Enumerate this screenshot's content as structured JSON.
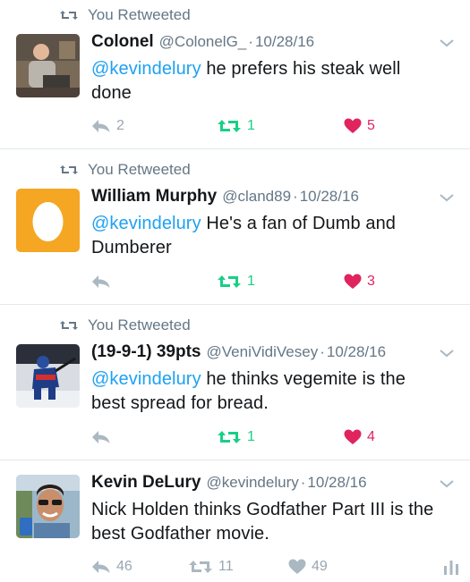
{
  "retweet_label": "You Retweeted",
  "colors": {
    "link": "#1da1f2",
    "retweet_green": "#19cf86",
    "like_red": "#e0245e",
    "muted": "#657786",
    "action_grey": "#9aa6b2"
  },
  "tweets": [
    {
      "retweeted_by_you": true,
      "name": "Colonel",
      "handle": "@ColonelG_",
      "date": "10/28/16",
      "mention": "@kevindelury",
      "text": " he prefers his steak well done",
      "reply_count": "2",
      "retweet_count": "1",
      "like_count": "5",
      "avatar": "person-at-desk-photo",
      "retweeted": true,
      "liked": true
    },
    {
      "retweeted_by_you": true,
      "name": "William Murphy",
      "handle": "@cland89",
      "date": "10/28/16",
      "mention": "@kevindelury",
      "text": " He's a fan of Dumb and Dumberer",
      "reply_count": "",
      "retweet_count": "1",
      "like_count": "3",
      "avatar": "default-egg-avatar",
      "retweeted": true,
      "liked": true
    },
    {
      "retweeted_by_you": true,
      "name": "(19-9-1) 39pts",
      "handle": "@VeniVidiVesey",
      "date": "10/28/16",
      "mention": "@kevindelury",
      "text": " he thinks vegemite is the best spread for bread.",
      "reply_count": "",
      "retweet_count": "1",
      "like_count": "4",
      "avatar": "hockey-player-photo",
      "retweeted": true,
      "liked": true
    },
    {
      "retweeted_by_you": false,
      "name": "Kevin DeLury",
      "handle": "@kevindelury",
      "date": "10/28/16",
      "mention": "",
      "text": "Nick Holden thinks Godfather Part III is the best Godfather movie.",
      "reply_count": "46",
      "retweet_count": "11",
      "like_count": "49",
      "avatar": "man-with-sunglasses-photo",
      "retweeted": false,
      "liked": false
    }
  ]
}
